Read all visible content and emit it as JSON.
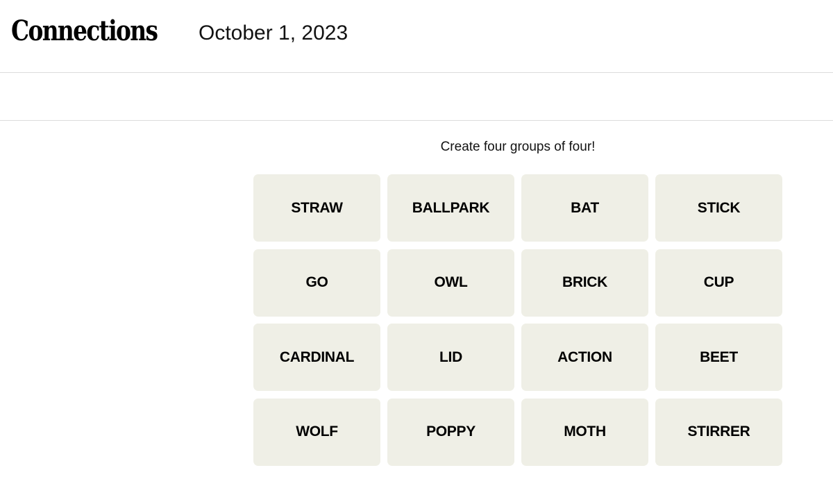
{
  "header": {
    "title": "Connections",
    "date": "October 1, 2023"
  },
  "game": {
    "instructions": "Create four groups of four!",
    "tiles": [
      "STRAW",
      "BALLPARK",
      "BAT",
      "STICK",
      "GO",
      "OWL",
      "BRICK",
      "CUP",
      "CARDINAL",
      "LID",
      "ACTION",
      "BEET",
      "WOLF",
      "POPPY",
      "MOTH",
      "STIRRER"
    ]
  },
  "colors": {
    "tile_background": "#efefe6",
    "divider": "#dcdcdc"
  }
}
